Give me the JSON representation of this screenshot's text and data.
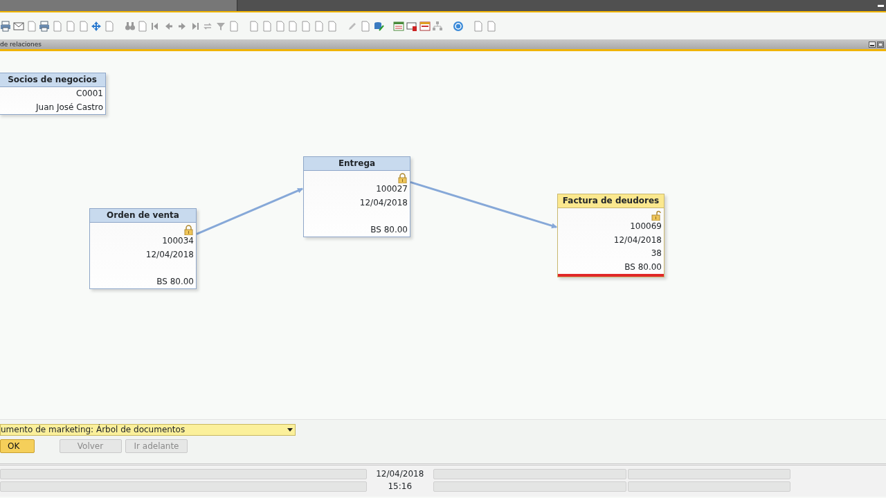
{
  "window": {
    "title": "de relaciones"
  },
  "nodes": [
    {
      "title": "Socios de negocios",
      "selected": false,
      "marked": false,
      "fields": [
        {
          "kind": "code",
          "text": "C0001"
        },
        {
          "kind": "name",
          "text": "Juan José Castro"
        }
      ]
    },
    {
      "title": "Orden de venta",
      "selected": false,
      "locked": true,
      "marked": false,
      "fields": [
        {
          "kind": "number",
          "text": "100034"
        },
        {
          "kind": "date",
          "text": "12/04/2018"
        },
        {
          "kind": "amount",
          "text": "BS 80.00"
        }
      ]
    },
    {
      "title": "Entrega",
      "selected": false,
      "locked": true,
      "marked": false,
      "fields": [
        {
          "kind": "number",
          "text": "100027"
        },
        {
          "kind": "date",
          "text": "12/04/2018"
        },
        {
          "kind": "amount",
          "text": "BS 80.00"
        }
      ]
    },
    {
      "title": "Factura de deudores",
      "selected": true,
      "locked": false,
      "marked": true,
      "fields": [
        {
          "kind": "number",
          "text": "100069"
        },
        {
          "kind": "date",
          "text": "12/04/2018"
        },
        {
          "kind": "extra",
          "text": "38"
        },
        {
          "kind": "amount",
          "text": "BS 80.00"
        }
      ]
    }
  ],
  "view_select": {
    "value": "umento de marketing: Árbol de documentos"
  },
  "buttons": [
    {
      "label": "OK",
      "kind": "primary",
      "disabled": false
    },
    {
      "label": "Volver",
      "kind": "secondary",
      "disabled": true
    },
    {
      "label": "Ir adelante",
      "kind": "secondary",
      "disabled": true
    }
  ],
  "status_bar": {
    "date": "12/04/2018",
    "time": "15:16"
  }
}
